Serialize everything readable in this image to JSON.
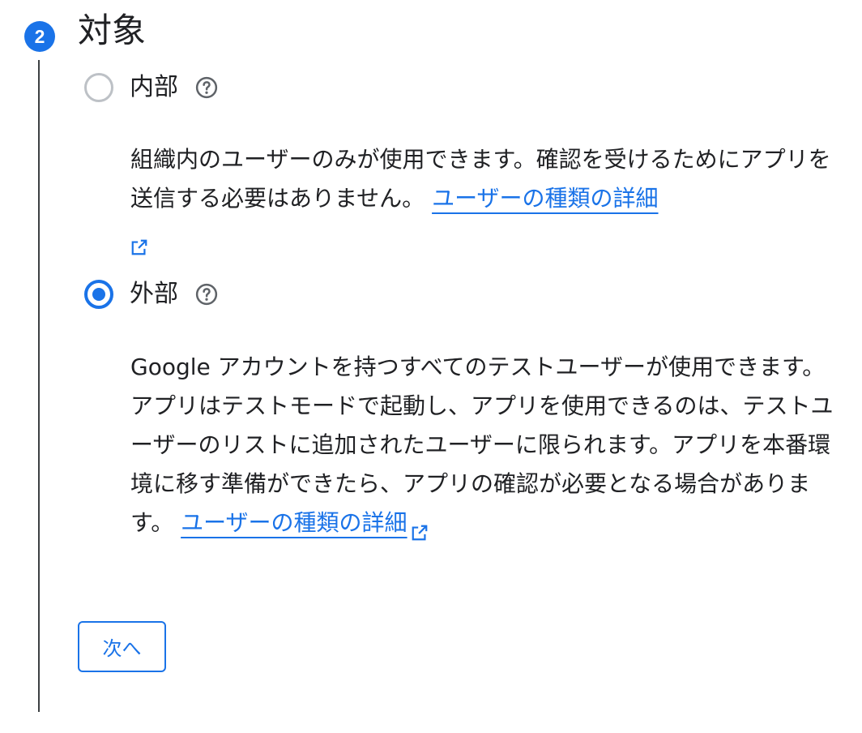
{
  "step": {
    "number": "2",
    "title": "対象"
  },
  "options": {
    "internal": {
      "label": "内部",
      "selected": false,
      "description": "組織内のユーザーのみが使用できます。確認を受けるためにアプリを送信する必要はありません。",
      "link_text": "ユーザーの種類の詳細"
    },
    "external": {
      "label": "外部",
      "selected": true,
      "description": "Google アカウントを持つすべてのテストユーザーが使用できます。アプリはテストモードで起動し、アプリを使用できるのは、テストユーザーのリストに追加されたユーザーに限られます。アプリを本番環境に移す準備ができたら、アプリの確認が必要となる場合があります。",
      "link_text": "ユーザーの種類の詳細"
    }
  },
  "next_button_label": "次へ",
  "icons": {
    "help": "help-circle-icon",
    "external_link": "open-in-new-icon"
  },
  "colors": {
    "accent": "#1a73e8",
    "text": "#202124",
    "radio_unchecked": "#bdc1c6",
    "step_line": "#3c4043"
  }
}
